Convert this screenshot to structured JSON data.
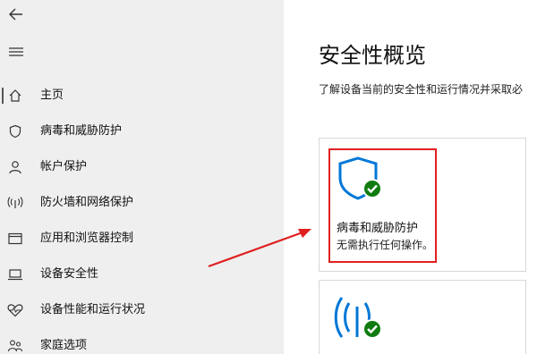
{
  "sidebar": {
    "items": [
      {
        "label": "主页",
        "icon": "home-icon",
        "active": true
      },
      {
        "label": "病毒和威胁防护",
        "icon": "shield-icon"
      },
      {
        "label": "帐户保护",
        "icon": "person-icon"
      },
      {
        "label": "防火墙和网络保护",
        "icon": "wifi-antenna-icon"
      },
      {
        "label": "应用和浏览器控制",
        "icon": "browser-window-icon"
      },
      {
        "label": "设备安全性",
        "icon": "laptop-icon"
      },
      {
        "label": "设备性能和运行状况",
        "icon": "heart-pulse-icon"
      },
      {
        "label": "家庭选项",
        "icon": "family-icon"
      }
    ]
  },
  "main": {
    "title": "安全性概览",
    "subtitle": "了解设备当前的安全性和运行情况并采取必"
  },
  "cards": [
    {
      "title": "病毒和威胁防护",
      "status": "无需执行任何操作。",
      "icon": "shield-check-icon"
    },
    {
      "icon": "firewall-antenna-check-icon"
    }
  ],
  "colors": {
    "accent": "#0078d7",
    "success": "#107c10",
    "highlight": "#e02020",
    "sidebar_bg": "#efefef"
  }
}
